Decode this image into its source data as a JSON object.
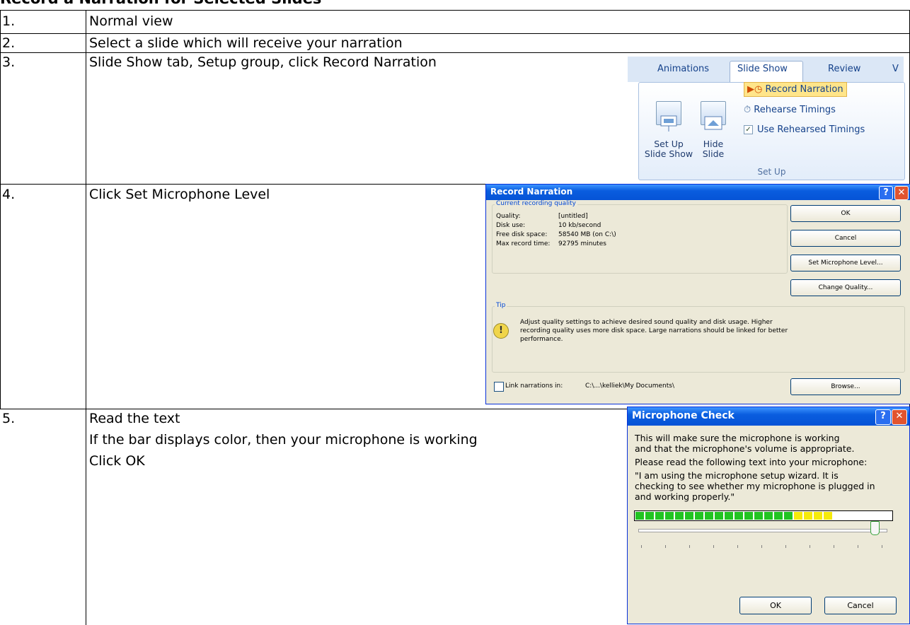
{
  "heading": "Record a Narration for Selected Slides",
  "steps": [
    {
      "num": "1.",
      "lines": [
        "Normal view"
      ]
    },
    {
      "num": "2.",
      "lines": [
        "Select a slide which will receive your narration"
      ]
    },
    {
      "num": "3.",
      "lines": [
        "Slide Show tab, Setup group, click Record Narration"
      ]
    },
    {
      "num": "4.",
      "lines": [
        "Click Set Microphone Level"
      ]
    },
    {
      "num": "5.",
      "lines": [
        "Read the text",
        "If the bar displays color, then your microphone is working",
        "Click OK"
      ]
    }
  ],
  "ribbon": {
    "tabs": [
      "Animations",
      "Slide Show",
      "Review",
      "V"
    ],
    "active_tab": "Slide Show",
    "setup_show": "Set Up\nSlide Show",
    "hide_slide": "Hide\nSlide",
    "record_narration": "Record Narration",
    "rehearse_timings": "Rehearse Timings",
    "use_rehearsed_timings": "Use Rehearsed Timings",
    "use_rehearsed_checked": true,
    "group_label": "Set Up",
    "icons": [
      "setup-slideshow-icon",
      "hide-slide-icon",
      "record-narration-icon",
      "rehearse-timings-icon"
    ]
  },
  "record_dialog": {
    "title": "Record Narration",
    "section_current": "Current recording quality",
    "rows": [
      {
        "label": "Quality:",
        "value": "[untitled]"
      },
      {
        "label": "Disk use:",
        "value": "10 kb/second"
      },
      {
        "label": "Free disk space:",
        "value": "58540 MB (on C:\\)"
      },
      {
        "label": "Max record time:",
        "value": "92795 minutes"
      }
    ],
    "buttons": {
      "ok": "OK",
      "cancel": "Cancel",
      "set_mic": "Set Microphone Level...",
      "change_quality": "Change Quality...",
      "browse": "Browse..."
    },
    "tip_label": "Tip",
    "tip_lines": [
      "Adjust quality settings to achieve desired sound quality and disk usage. Higher",
      "recording quality uses more disk space. Large narrations should be linked for better",
      "performance."
    ],
    "link_label": "Link narrations in:",
    "link_path": "C:\\...\\kelliek\\My Documents\\",
    "link_checked": false
  },
  "mic_dialog": {
    "title": "Microphone Check",
    "lines": [
      "This will make sure the microphone is working",
      "and that the microphone's volume is appropriate.",
      "Please read the following text into your microphone:",
      "\"I am using the microphone setup wizard. It is",
      "checking to see whether my microphone is plugged in",
      "and working properly.\""
    ],
    "meter_green_segments": 16,
    "meter_yellow_segments": 4,
    "slider_level": 0.95,
    "ok": "OK",
    "cancel": "Cancel",
    "colors": {
      "green": "#21c421",
      "yellow": "#f5ea0b"
    }
  }
}
